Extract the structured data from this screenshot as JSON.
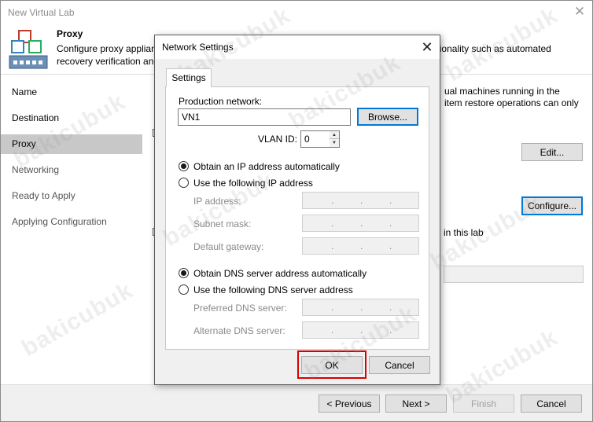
{
  "wizard": {
    "title": "New Virtual Lab",
    "close_glyph": "✕",
    "step_title": "Proxy",
    "step_desc_line1": "Configure proxy applian",
    "step_desc_line1_tail": "functionality such as automated",
    "step_desc_line2": "recovery verification and",
    "nav": [
      "Name",
      "Destination",
      "Proxy",
      "Networking",
      "Ready to Apply",
      "Applying Configuration"
    ],
    "active_nav": "Proxy",
    "content": {
      "text_right_line1": "ual machines running in the",
      "text_right_line2": "item restore operations can only",
      "lab_text": "in this lab",
      "edit_label": "Edit...",
      "configure_label": "Configure..."
    },
    "footer": {
      "previous": "< Previous",
      "next": "Next >",
      "finish": "Finish",
      "cancel": "Cancel"
    }
  },
  "dialog": {
    "title": "Network Settings",
    "close_glyph": "✕",
    "tab": "Settings",
    "production_network_label": "Production network:",
    "production_network_value": "VN1",
    "browse_label": "Browse...",
    "vlan_label": "VLAN ID:",
    "vlan_value": "0",
    "ip_auto_label": "Obtain an IP address automatically",
    "ip_manual_label": "Use the following IP address",
    "ip_address_label": "IP address:",
    "subnet_mask_label": "Subnet mask:",
    "default_gateway_label": "Default gateway:",
    "dns_auto_label": "Obtain DNS server address automatically",
    "dns_manual_label": "Use the following DNS server address",
    "preferred_dns_label": "Preferred DNS server:",
    "alternate_dns_label": "Alternate DNS server:",
    "ip_dot": ".",
    "ok_label": "OK",
    "cancel_label": "Cancel"
  },
  "watermark_text": "bakicubuk",
  "colors": {
    "highlight": "#d90000",
    "focus": "#0078d7",
    "active_nav": "#c8c8c8"
  }
}
